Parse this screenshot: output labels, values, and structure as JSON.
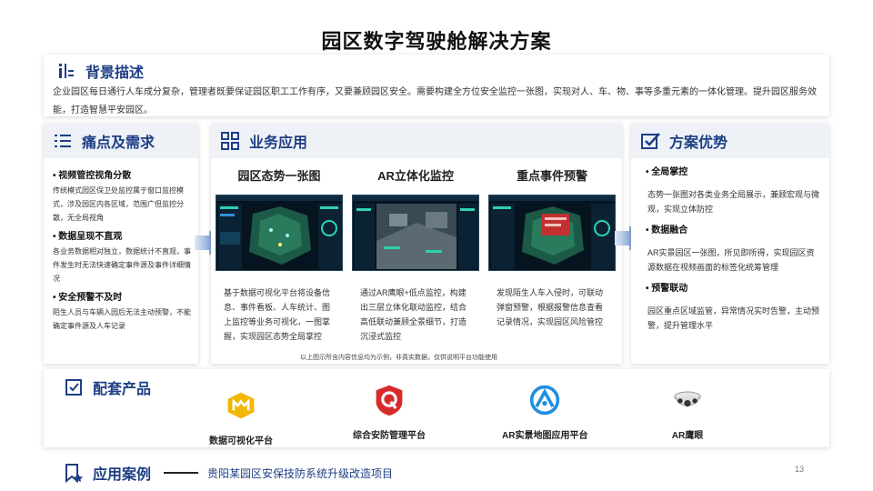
{
  "title": "园区数字驾驶舱解决方案",
  "background": {
    "heading": "背景描述",
    "text": "企业园区每日通行人车成分复杂，管理者既要保证园区职工工作有序，又要兼顾园区安全。需要构建全方位安全监控一张图，实现对人、车、物、事等多重元素的一体化管理。提升园区服务效能，打造智慧平安园区。"
  },
  "pain": {
    "heading": "痛点及需求",
    "items": [
      {
        "title": "视频管控视角分散",
        "desc": "传统模式园区保卫处监控属于窗口监控模式，涉及园区内各区域，范围广但监控分散，无全局视角"
      },
      {
        "title": "数据呈现不直观",
        "desc": "各业务数据相对独立，数据统计不直观，事件发生时无法快速确定事件源及事件详细情况"
      },
      {
        "title": "安全预警不及时",
        "desc": "陌生人员与车辆入园后无法主动预警，不能确定事件源及人车记录"
      }
    ]
  },
  "business": {
    "heading": "业务应用",
    "columns": [
      {
        "title": "园区态势一张图",
        "desc": "基于数据可视化平台将设备信息、事件看板、人车统计、图上监控等业务可视化，一图掌握，实现园区态势全局掌控"
      },
      {
        "title": "AR立体化监控",
        "desc": "通过AR鹰眼+低点监控，构建出三层立体化联动监控，结合高低联动兼顾全景细节，打造沉浸式监控"
      },
      {
        "title": "重点事件预警",
        "desc": "发现陌生人车入侵时，可联动弹窗预警，根据报警信息查看记录情况，实现园区风险管控"
      }
    ],
    "disclaimer": "以上图示所含内容信息均为示例，非真实数据，仅供说明平台功能使用"
  },
  "advantages": {
    "heading": "方案优势",
    "items": [
      {
        "title": "全局掌控",
        "desc": "态势一张图对各类业务全局展示，兼顾宏观与微观，实现立体防控"
      },
      {
        "title": "数据融合",
        "desc": "AR实景园区一张图，所见即所得，实现园区资源数据在视频画面的标签化统筹管理"
      },
      {
        "title": "预警联动",
        "desc": "园区重点区域监管，异常情况实时告警，主动预警，提升管理水平"
      }
    ]
  },
  "products": {
    "heading": "配套产品",
    "items": [
      {
        "label": "数据可视化平台",
        "icon": "dataviz-logo-icon",
        "color": "#f2b705"
      },
      {
        "label": "综合安防管理平台",
        "icon": "security-platform-logo-icon",
        "color": "#d62b2b"
      },
      {
        "label": "AR实景地图应用平台",
        "icon": "ar-map-logo-icon",
        "color": "#1f8fe0"
      },
      {
        "label": "AR鹰眼",
        "icon": "camera-icon",
        "color": "#555555"
      }
    ]
  },
  "cases": {
    "heading": "应用案例",
    "text": "贵阳某园区安保技防系统升级改造项目"
  },
  "page_number": "13",
  "colors": {
    "accent": "#1e3f85",
    "arrow": "#4a78c2"
  }
}
